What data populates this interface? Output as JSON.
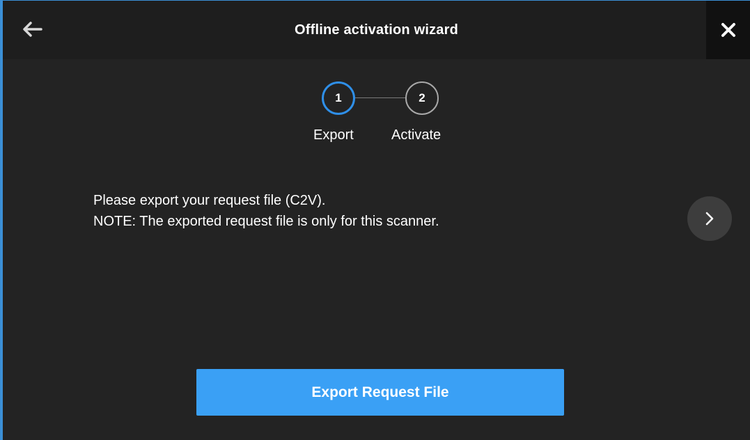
{
  "window": {
    "title": "Offline activation wizard",
    "accent_color": "#3b8fd6",
    "background_color": "#232323"
  },
  "titlebar": {
    "back_icon": "arrow-left-icon",
    "close_icon": "close-icon"
  },
  "stepper": {
    "steps": [
      {
        "number": "1",
        "label": "Export",
        "state": "active"
      },
      {
        "number": "2",
        "label": "Activate",
        "state": "inactive"
      }
    ],
    "active_color": "#2f8fe8"
  },
  "message": {
    "line1": "Please export your request file (C2V).",
    "line2": "NOTE: The exported request file is only for this scanner."
  },
  "navigation": {
    "next_icon": "chevron-right-icon"
  },
  "actions": {
    "export_label": "Export Request File",
    "export_color": "#3aa0f5"
  }
}
